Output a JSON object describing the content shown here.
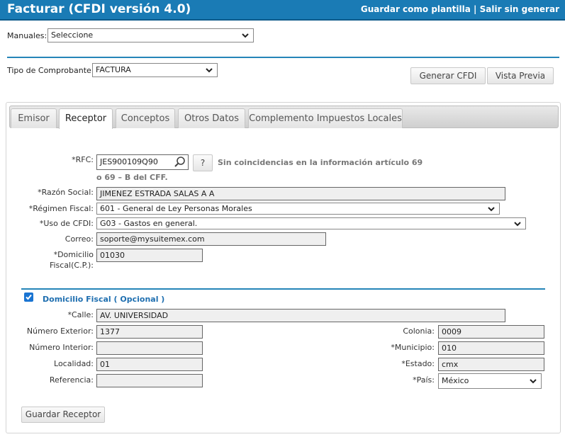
{
  "header": {
    "title": "Facturar (CFDI versión 4.0)",
    "save_template": "Guardar como plantilla",
    "separator": "|",
    "exit": "Salir sin generar"
  },
  "manuales": {
    "label": "Manuales:",
    "value": "Seleccione"
  },
  "tipo": {
    "label": "Tipo de Comprobante:",
    "value": "FACTURA"
  },
  "actions": {
    "generate": "Generar CFDI",
    "preview": "Vista Previa"
  },
  "tabs": [
    {
      "label": "Emisor"
    },
    {
      "label": "Receptor"
    },
    {
      "label": "Conceptos"
    },
    {
      "label": "Otros Datos"
    },
    {
      "label": "Complemento Impuestos Locales"
    }
  ],
  "receptor": {
    "rfc_label": "*RFC:",
    "rfc_value": "JES900109Q90",
    "help_button": "?",
    "rfc_note_1": "Sin coincidencias en la información artículo 69",
    "rfc_note_2": "o 69 – B del CFF.",
    "razon_label": "*Razón Social:",
    "razon_value": "JIMENEZ ESTRADA SALAS A A",
    "regimen_label": "*Régimen Fiscal:",
    "regimen_value": "601 - General de Ley Personas Morales",
    "uso_label": "*Uso de CFDI:",
    "uso_value": "G03 - Gastos en general.",
    "correo_label": "Correo:",
    "correo_value": "soporte@mysuitemex.com",
    "domicilio_label_1": "*Domicilio",
    "domicilio_label_2": "Fiscal(C.P.):",
    "domicilio_value": "01030"
  },
  "domicilio": {
    "checked": true,
    "title": "Domicilio Fiscal ( Opcional )",
    "calle_label": "*Calle:",
    "calle_value": "AV. UNIVERSIDAD",
    "num_ext_label": "Número Exterior:",
    "num_ext_value": "1377",
    "num_int_label": "Número Interior:",
    "num_int_value": "",
    "localidad_label": "Localidad:",
    "localidad_value": "01",
    "referencia_label": "Referencia:",
    "referencia_value": "",
    "colonia_label": "Colonia:",
    "colonia_value": "0009",
    "municipio_label": "*Municipio:",
    "municipio_value": "010",
    "estado_label": "*Estado:",
    "estado_value": "cmx",
    "pais_label": "*País:",
    "pais_value": "México"
  },
  "save_receptor": "Guardar Receptor",
  "colors": {
    "header": "#1a7bb5",
    "accent": "#2585b8",
    "checkbox": "#1a74d2"
  },
  "icons": [
    "chevron-down-icon",
    "search-icon",
    "checkbox-icon"
  ]
}
